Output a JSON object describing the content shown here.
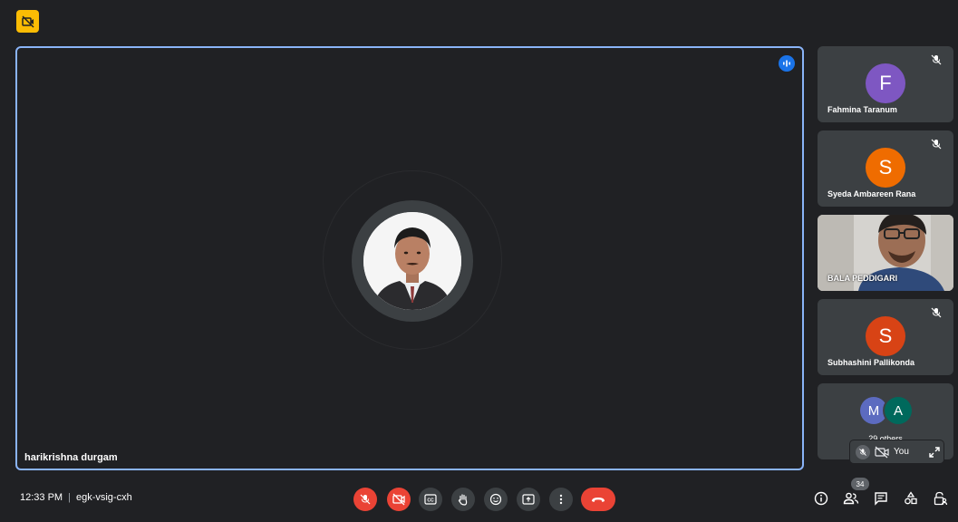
{
  "main": {
    "speaker_name": "harikrishna durgam"
  },
  "participants": [
    {
      "name": "Fahmina Taranum",
      "initial": "F",
      "color": "#7e57c2",
      "muted": true
    },
    {
      "name": "Syeda Ambareen Rana",
      "initial": "S",
      "color": "#ef6c00",
      "muted": true
    },
    {
      "name": "BALA PEDDIGARI",
      "initial": "",
      "color": "",
      "muted": false
    },
    {
      "name": "Subhashini Pallikonda",
      "initial": "S",
      "color": "#e64a19",
      "muted": true
    }
  ],
  "others": {
    "avatars": [
      {
        "initial": "M",
        "color": "#5c6bc0"
      },
      {
        "initial": "A",
        "color": "#00695c"
      }
    ],
    "label": "29 others"
  },
  "self": {
    "label": "You"
  },
  "bottom": {
    "time": "12:33 PM",
    "separator": "|",
    "meeting_code": "egk-vsig-cxh",
    "participant_count": "34"
  },
  "controls": [
    {
      "name": "mic-off",
      "state": "off"
    },
    {
      "name": "camera-off",
      "state": "off"
    },
    {
      "name": "captions",
      "state": "on"
    },
    {
      "name": "raise-hand",
      "state": "on"
    },
    {
      "name": "reactions",
      "state": "on"
    },
    {
      "name": "present",
      "state": "on"
    },
    {
      "name": "more-options",
      "state": "on"
    },
    {
      "name": "leave-call",
      "state": "hangup"
    }
  ],
  "colors": {
    "background": "#202124",
    "tile": "#3c4043",
    "active_border": "#8ab4f8",
    "danger": "#ea4335",
    "warning_badge": "#fbbc04"
  }
}
